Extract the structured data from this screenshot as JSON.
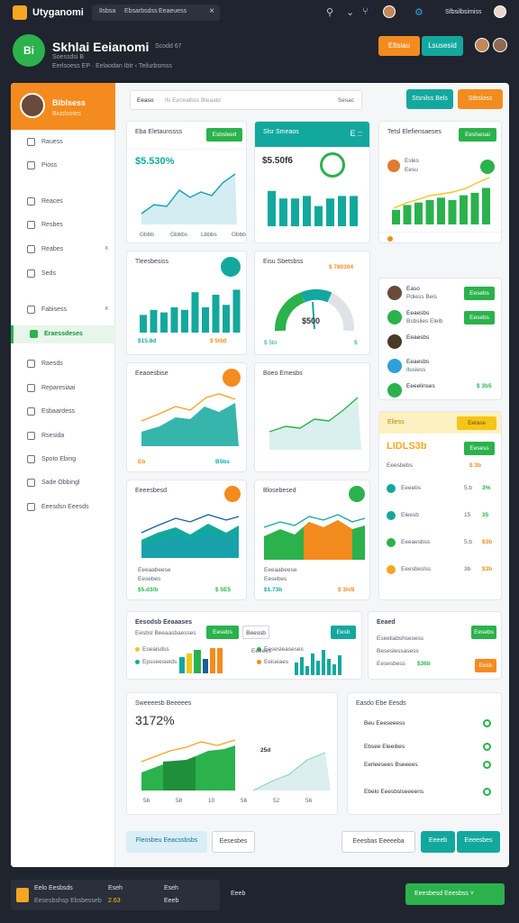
{
  "topbar": {
    "title": "Utyganomi",
    "tabs": [
      "Ilsbsa",
      "Ebsarbsdss",
      "Eeaeuess"
    ],
    "close": "×",
    "icons": [
      "search-icon",
      "dropdown-icon",
      "branch-icon",
      "avatar",
      "settings-icon"
    ],
    "user": "Sfbsilbsimiss"
  },
  "header": {
    "logo": "Bi",
    "title": "Skhlai Eeianomi",
    "code": "Scodd 67",
    "subtitle": "Soessdsi B",
    "breadcrumb": [
      "Eerlsoess EP",
      "Eelaodan Ibtr",
      "Teilurbsmss"
    ],
    "btn1": "Eltsiau",
    "btn2": "Lsusesid"
  },
  "sidebar": {
    "name": "Biblsess",
    "role": "Biuslsotes",
    "items": [
      {
        "label": "Rauess",
        "count": ""
      },
      {
        "label": "Pioss",
        "count": ""
      },
      {
        "label": "Reaces",
        "count": ""
      },
      {
        "label": "Resbes",
        "count": ""
      },
      {
        "label": "Reabes",
        "count": "x"
      },
      {
        "label": "Seds",
        "count": ""
      },
      {
        "label": "Fabisess",
        "count": "x"
      },
      {
        "label": "Eraessdeses",
        "count": ""
      },
      {
        "label": "Raesds",
        "count": ""
      },
      {
        "label": "Reparesiaai",
        "count": ""
      },
      {
        "label": "Esbaardess",
        "count": ""
      },
      {
        "label": "Rsesida",
        "count": ""
      },
      {
        "label": "Spoto Ebing",
        "count": ""
      },
      {
        "label": "Sade Obbingl",
        "count": ""
      },
      {
        "label": "Eeesdsn Eeesds",
        "count": ""
      }
    ],
    "active": 7
  },
  "toolbar": {
    "search_label": "Eeaso",
    "search_placeholder": "lfs  Eecealbss Bleaald",
    "search_btn": "Sesac",
    "btn1": "Stsnilss Bels",
    "btn2": "Stbsloss"
  },
  "colors": {
    "green": "#2bb24c",
    "teal": "#13a89e",
    "orange": "#f48b1f",
    "yellow": "#f5c518"
  },
  "cards": {
    "c1": {
      "title": "Eba Eletaunssss",
      "btn": "Esbsleed",
      "value": "$5.530%",
      "ticks": [
        "Gbbb",
        "Gbbbs",
        "Lbbbs",
        "Gbbbb"
      ]
    },
    "c2": {
      "title": "Slsr Smeaos",
      "value": "$5.50f6",
      "icon": "E ::",
      "ticks": [
        "e8",
        "BB",
        "BB",
        "BB"
      ]
    },
    "c3": {
      "title": "Tetsl Elefiensaeses",
      "btn": "Eeslsesai",
      "value1": "Esles",
      "value2": "Eesu",
      "ticks": [
        "1fl",
        "1bp",
        "1bb"
      ],
      "foot": "Eeesbesidss",
      "foot_value": "$35"
    },
    "c4": {
      "title": "Tleesbesiss",
      "ticks": [
        "$50",
        "25",
        "25",
        "30"
      ],
      "value": "$15.8d",
      "value2": "$ 5tb0"
    },
    "c5": {
      "title": "Eisu Sbetsbss",
      "value": "$ 780304",
      "gauge_value": "$500",
      "ticks": [
        "$ 5bi",
        "$"
      ]
    },
    "c6": {
      "title": "Eeaoesbise",
      "ticks": [
        "3bp",
        "8b",
        "9b",
        "8b"
      ],
      "tag": "Eb",
      "tag2": "B5bs"
    },
    "c7": {
      "title": "Boeo Emesbs",
      "ticks": [
        "5b",
        "5b"
      ]
    },
    "c8": {
      "title": "Eeeesbesd",
      "ticks": [
        "5bs",
        "3bs",
        "5bs"
      ],
      "sub": "Eeeaabeese",
      "sub2": "Eesebes",
      "v1": "$5.d3/b",
      "v2": "$ 5E5"
    },
    "c9": {
      "title": "Blosebesed",
      "ticks": [
        "5bs",
        "85",
        "5bs",
        "5bs"
      ],
      "sub": "Eeeaabeese",
      "sub2": "Eesebes",
      "v1": "$1.73b",
      "v2": "$ 3h/8"
    },
    "people": {
      "rows": [
        {
          "name": "Easo",
          "sub": "Pdiess Beis",
          "btn": "Eesebs"
        },
        {
          "name": "Eeaesbs",
          "sub": "Bsbslies Eleib",
          "btn": "Eesebs"
        },
        {
          "name": "Eeaesbs",
          "sub": "",
          "btn": ""
        },
        {
          "name": "Eeaesbs",
          "sub": "Ilssiess",
          "btn": ""
        },
        {
          "name": "Eeeelinses",
          "sub": "",
          "btn": "",
          "value": "$ 3b5"
        }
      ]
    },
    "promo": {
      "title": "Eliess",
      "tag": "Eelase",
      "value": "LIDLS3b",
      "sub": "Eeesbebs",
      "btn": "Eesess",
      "sub_value": "$ 3b",
      "rows": [
        {
          "label": "Eeeebs",
          "v": "5.b",
          "p": "3%"
        },
        {
          "label": "Eleesb",
          "v": "15",
          "p": "35"
        },
        {
          "label": "Eeeaesbss",
          "v": "5.b",
          "p": "$3b"
        },
        {
          "label": "Eeesbeslss",
          "v": "3b",
          "p": "$3b"
        }
      ]
    },
    "wide1": {
      "title": "Eesodsb Eeaaases",
      "btn": "Eesebs",
      "btn2": "Beessb",
      "sub": "Eesbsl Beeaasbaesses",
      "legend": [
        "Eseaisdss",
        "Epsseesieids",
        "Eesesleaseses",
        "Eeiueaes"
      ],
      "label2": "Eeeees",
      "bad": "Eesb"
    },
    "wide2": {
      "title": "Eeaed",
      "btn": "Eesebs",
      "rows": [
        "Eseeliabshsesess",
        "Beseslessasess",
        "Eesesbess"
      ],
      "value": "$36b",
      "btn2": "Eesb"
    },
    "main": {
      "title": "Sweeeesb Beeeees",
      "value": "3172%",
      "ticks": [
        "56",
        "58",
        "10",
        "56",
        "52",
        "56"
      ],
      "marker": "25d"
    },
    "list": {
      "title": "Easdo Ebe Eesds",
      "items": [
        "Beu Eeeseeess",
        "Ebsee Eleeibes",
        "Eerleesees Bseeees",
        "Ebelo Eeesbslseeeens"
      ]
    }
  },
  "bottom": {
    "btn1": "Fleosbeu Eeacssbsbs",
    "btn2": "Eesesbes",
    "btn3": "Eeesbas Eeeeeba",
    "btn4": "Eeeeb",
    "btn5": "Eeeesbes"
  },
  "footer": {
    "brand": "Eelo Eesbsds",
    "brand_sub": "Eesesbshsp Ebsbesseb",
    "brand_value": "2.63",
    "col1": "Eseh",
    "col2": "Eseh",
    "col2_sub": "Eeeb",
    "col3": "Eeeb",
    "cta": "Eeesbesd Eeesbss ˅"
  }
}
